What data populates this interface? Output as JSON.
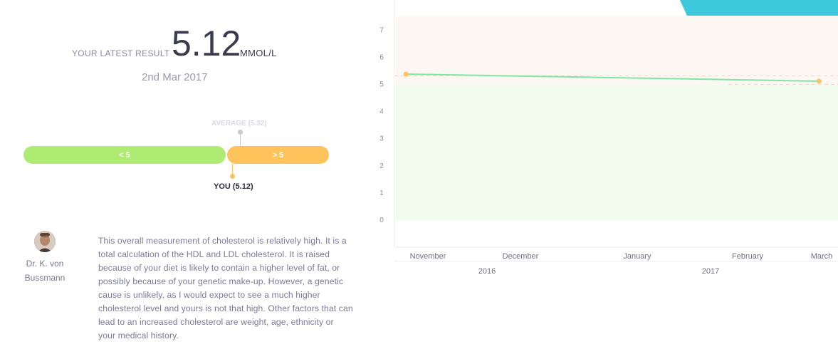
{
  "result": {
    "label": "YOUR LATEST RESULT",
    "value": "5.12",
    "unit": "MMOL/L",
    "date": "2nd Mar 2017"
  },
  "range_bar": {
    "low_label": "< 5",
    "high_label": "> 5",
    "average_label": "AVERAGE (5.32)",
    "you_label": "YOU (5.12)",
    "low_color": "#aeeb72",
    "high_color": "#ffc35c"
  },
  "doctor": {
    "name_line1": "Dr. K. von",
    "name_line2": "Bussmann",
    "commentary": "This overall measurement of cholesterol is relatively high. It is a total calculation of the HDL and LDL cholesterol. It is raised because of your diet is likely to contain a higher level of fat, or possibly because of your genetic make-up. However, a genetic cause is unlikely, as I would expect to see a much higher cholesterol level and yours is not that high. Other factors that can lead to an increased cholesterol are weight, age, ethnicity or your medical history."
  },
  "chart_data": {
    "type": "line",
    "y_ticks": [
      "0",
      "1",
      "2",
      "3",
      "4",
      "5",
      "6",
      "7"
    ],
    "ylim": [
      0,
      7.5
    ],
    "x_ticks": [
      "November",
      "December",
      "January",
      "February",
      "March"
    ],
    "year_labels": [
      "2016",
      "2017"
    ],
    "series": [
      {
        "x": [
          "2016-10-30",
          "2017-03-02"
        ],
        "values": [
          5.38,
          5.12
        ],
        "line_color": "#7fe6a3",
        "point_color": "#ffc35c"
      }
    ],
    "bands": [
      {
        "from": 0,
        "to": 5,
        "color": "#f1fbee"
      },
      {
        "from": 5,
        "to": 7.5,
        "color": "#fcf7f2"
      }
    ],
    "reference_values": [
      5.32,
      5.0
    ],
    "accent_color": "#3ec8dd"
  }
}
